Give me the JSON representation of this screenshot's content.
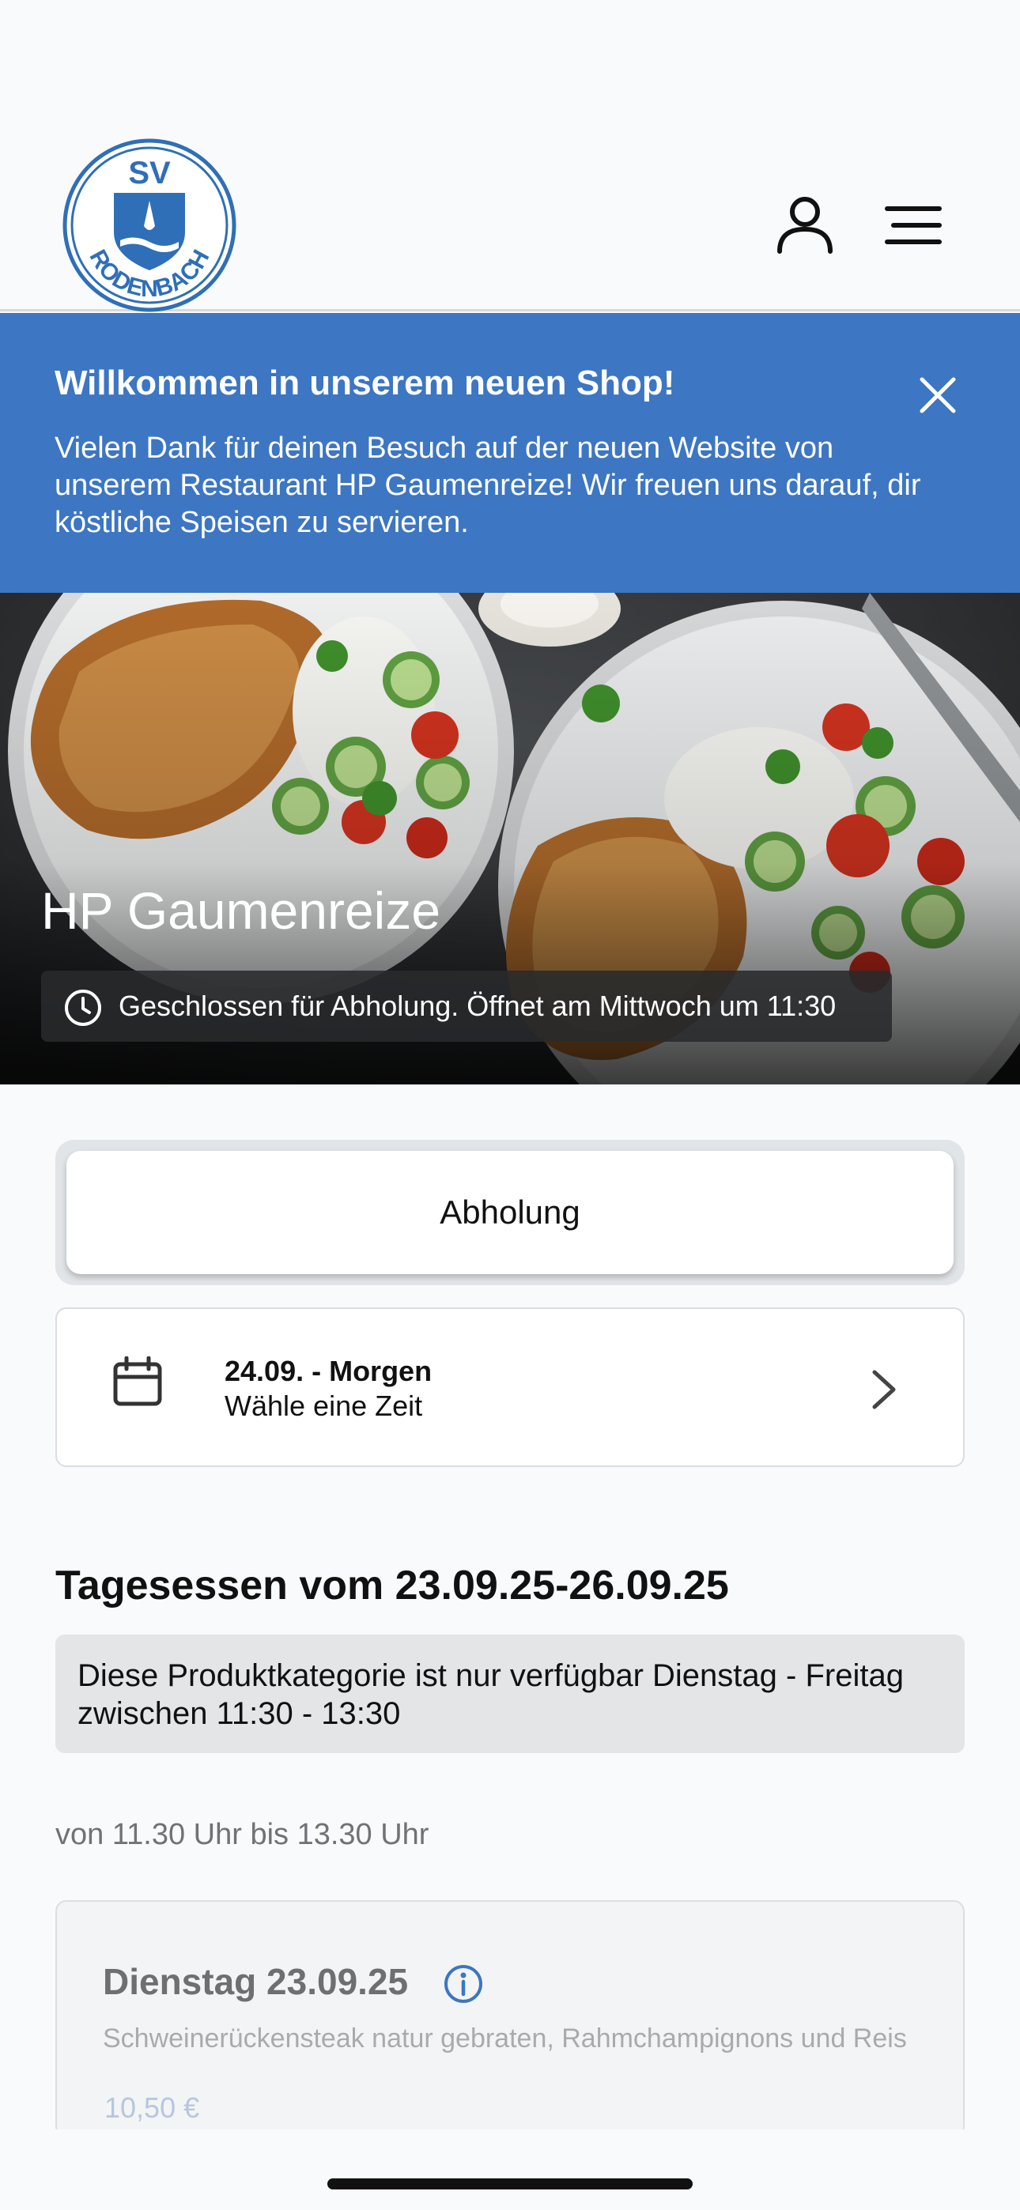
{
  "header": {
    "logo_text_top": "SV",
    "logo_text_bottom": "RODENBACH"
  },
  "banner": {
    "title": "Willkommen in unserem neuen Shop!",
    "text": "Vielen Dank für deinen Besuch auf der neuen Website von unserem Restaurant HP Gaumenreize! Wir freuen uns darauf, dir köstliche Speisen zu servieren."
  },
  "hero": {
    "restaurant_name": "HP Gaumenreize",
    "status": "Geschlossen für Abholung. Öffnet am Mittwoch um 11:30"
  },
  "order_mode": {
    "selected": "Abholung"
  },
  "date_picker": {
    "date": "24.09. - Morgen",
    "hint": "Wähle eine Zeit"
  },
  "category": {
    "title": "Tagesessen vom 23.09.25-26.09.25",
    "notice": "Diese Produktkategorie ist nur verfügbar Dienstag - Freitag zwischen 11:30 - 13:30",
    "time_note": "von 11.30 Uhr bis 13.30 Uhr"
  },
  "products": [
    {
      "name": "Dienstag 23.09.25",
      "description": "Schweinerückensteak natur gebraten, Rahmchampignons und Reis",
      "price": "10,50 €"
    }
  ],
  "colors": {
    "brand_blue": "#3d76c2",
    "background": "#f8fafc"
  },
  "icons": [
    "logo",
    "user-icon",
    "menu-icon",
    "close-icon",
    "clock-icon",
    "calendar-icon",
    "chevron-right-icon",
    "info-icon"
  ]
}
